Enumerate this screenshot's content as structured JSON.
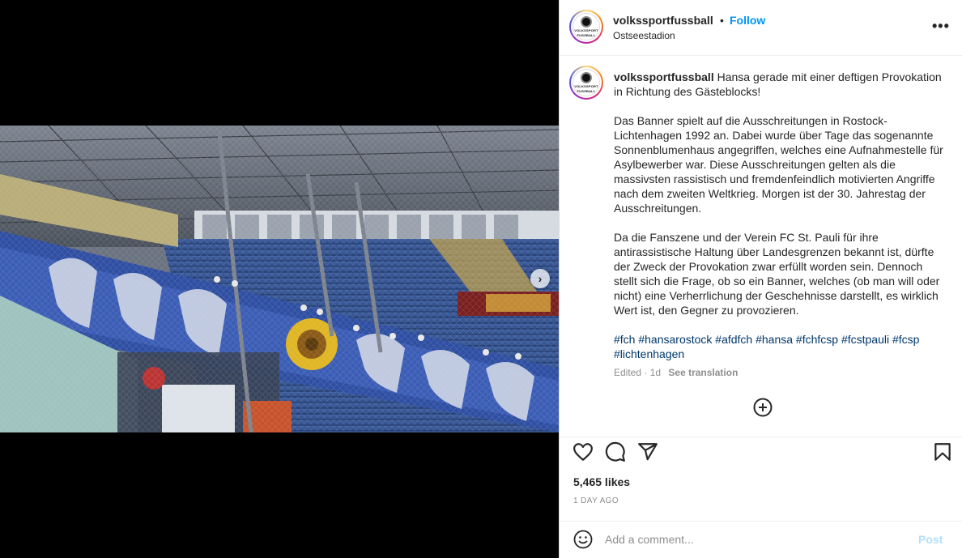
{
  "header": {
    "username": "volkssportfussball",
    "separator": "•",
    "follow_label": "Follow",
    "location": "Ostseestadion",
    "more_label": "•••"
  },
  "avatar": {
    "logo_text_line1": "VOLKSSPORT",
    "logo_text_line2": "FUSSBALL"
  },
  "caption": {
    "username": "volkssportfussball",
    "intro": "Hansa gerade mit einer deftigen Provokation in Richtung des Gästeblocks!",
    "paragraph2": "Das Banner spielt auf die Ausschreitungen in Rostock-Lichtenhagen 1992 an. Dabei wurde über Tage das sogenannte Sonnenblumenhaus angegriffen, welches eine Aufnahmestelle für Asylbewerber war. Diese Ausschreitungen gelten als die massivsten rassistisch und fremdenfeindlich motivierten Angriffe nach dem zweiten Weltkrieg. Morgen ist der 30. Jahrestag der Ausschreitungen.",
    "paragraph3": "Da die Fanszene und der Verein FC St. Pauli für ihre antirassistische Haltung über Landesgrenzen bekannt ist, dürfte der Zweck der Provokation zwar erfüllt worden sein. Dennoch stellt sich die Frage, ob so ein Banner, welches (ob man will oder nicht) eine Verherrlichung der Geschehnisse darstellt, es wirklich Wert ist, den Gegner zu provozieren.",
    "hashtags": "#fch #hansarostock #afdfch #hansa #fchfcsp #fcstpauli #fcsp #lichtenhagen",
    "edited": "Edited · 1d",
    "see_translation": "See translation"
  },
  "media": {
    "next_label": "›"
  },
  "stats": {
    "likes": "5,465 likes",
    "time_ago": "1 DAY AGO"
  },
  "comment": {
    "placeholder": "Add a comment...",
    "post_label": "Post"
  },
  "colors": {
    "follow": "#0095f6",
    "post_disabled": "#b2dffc",
    "hashtag": "#00376b",
    "muted": "#8e8e8e"
  },
  "icons": [
    "heart-icon",
    "comment-icon",
    "share-icon",
    "bookmark-icon",
    "emoji-icon",
    "plus-circle-icon",
    "chevron-right-icon",
    "more-icon"
  ]
}
